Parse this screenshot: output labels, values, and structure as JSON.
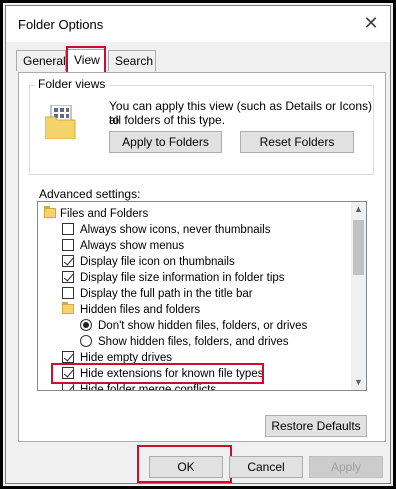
{
  "window": {
    "title": "Folder Options",
    "close_glyph": "✕"
  },
  "tabs": [
    {
      "label": "General",
      "active": false
    },
    {
      "label": "View",
      "active": true
    },
    {
      "label": "Search",
      "active": false
    }
  ],
  "folder_views": {
    "group_label": "Folder views",
    "description_line1": "You can apply this view (such as Details or Icons) to",
    "description_line2": "all folders of this type.",
    "apply_label": "Apply to Folders",
    "reset_label": "Reset Folders"
  },
  "advanced": {
    "label": "Advanced settings:",
    "items": [
      {
        "type": "folder",
        "label": "Files and Folders",
        "level": 0
      },
      {
        "type": "checkbox",
        "label": "Always show icons, never thumbnails",
        "checked": false,
        "level": 1
      },
      {
        "type": "checkbox",
        "label": "Always show menus",
        "checked": false,
        "level": 1
      },
      {
        "type": "checkbox",
        "label": "Display file icon on thumbnails",
        "checked": true,
        "level": 1
      },
      {
        "type": "checkbox",
        "label": "Display file size information in folder tips",
        "checked": true,
        "level": 1
      },
      {
        "type": "checkbox",
        "label": "Display the full path in the title bar",
        "checked": false,
        "level": 1
      },
      {
        "type": "folder",
        "label": "Hidden files and folders",
        "level": 1
      },
      {
        "type": "radio",
        "label": "Don't show hidden files, folders, or drives",
        "checked": true,
        "level": 2
      },
      {
        "type": "radio",
        "label": "Show hidden files, folders, and drives",
        "checked": false,
        "level": 2
      },
      {
        "type": "checkbox",
        "label": "Hide empty drives",
        "checked": true,
        "level": 1
      },
      {
        "type": "checkbox",
        "label": "Hide extensions for known file types",
        "checked": true,
        "level": 1
      },
      {
        "type": "checkbox",
        "label": "Hide folder merge conflicts",
        "checked": true,
        "level": 1
      }
    ]
  },
  "restore_label": "Restore Defaults",
  "footer": {
    "ok_label": "OK",
    "cancel_label": "Cancel",
    "apply_label": "Apply"
  }
}
